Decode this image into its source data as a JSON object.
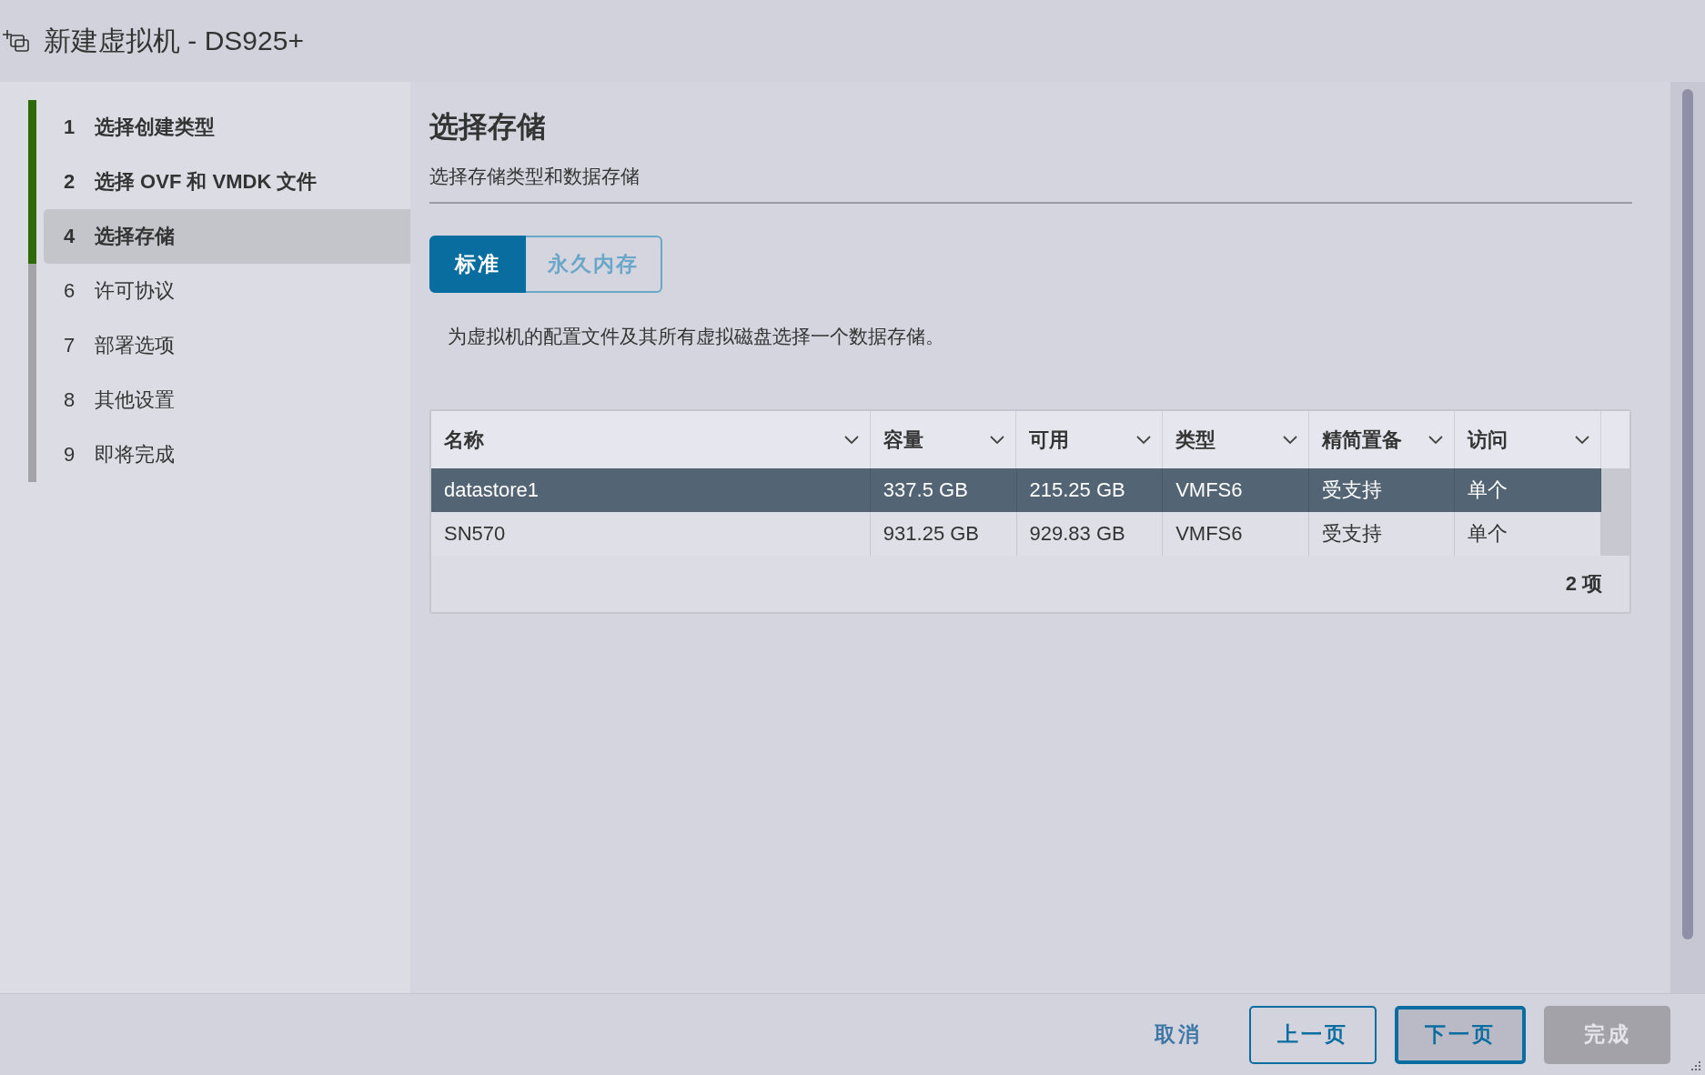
{
  "window": {
    "title": "新建虚拟机 - DS925+"
  },
  "steps": [
    {
      "number": "1",
      "label": "选择创建类型",
      "completed": true,
      "selected": false
    },
    {
      "number": "2",
      "label": "选择 OVF 和 VMDK 文件",
      "completed": true,
      "selected": false
    },
    {
      "number": "4",
      "label": "选择存储",
      "completed": true,
      "selected": true
    },
    {
      "number": "6",
      "label": "许可协议",
      "completed": false,
      "selected": false
    },
    {
      "number": "7",
      "label": "部署选项",
      "completed": false,
      "selected": false
    },
    {
      "number": "8",
      "label": "其他设置",
      "completed": false,
      "selected": false
    },
    {
      "number": "9",
      "label": "即将完成",
      "completed": false,
      "selected": false
    }
  ],
  "page": {
    "heading": "选择存储",
    "subheading": "选择存储类型和数据存储",
    "tabs": [
      {
        "label": "标准",
        "selected": true
      },
      {
        "label": "永久内存",
        "selected": false
      }
    ],
    "description": "为虚拟机的配置文件及其所有虚拟磁盘选择一个数据存储。",
    "table": {
      "columns": [
        "名称",
        "容量",
        "可用",
        "类型",
        "精简置备",
        "访问"
      ],
      "rows": [
        {
          "cells": [
            "datastore1",
            "337.5 GB",
            "215.25 GB",
            "VMFS6",
            "受支持",
            "单个"
          ],
          "selected": true
        },
        {
          "cells": [
            "SN570",
            "931.25 GB",
            "929.83 GB",
            "VMFS6",
            "受支持",
            "单个"
          ],
          "selected": false
        }
      ],
      "footer": "2 项"
    }
  },
  "buttons": [
    {
      "label": "取消",
      "kind": "link",
      "disabled": false,
      "focused": false
    },
    {
      "label": "上一页",
      "kind": "outline",
      "disabled": false,
      "focused": false
    },
    {
      "label": "下一页",
      "kind": "outline",
      "disabled": false,
      "focused": true
    },
    {
      "label": "完成",
      "kind": "solid",
      "disabled": true,
      "focused": false
    }
  ]
}
